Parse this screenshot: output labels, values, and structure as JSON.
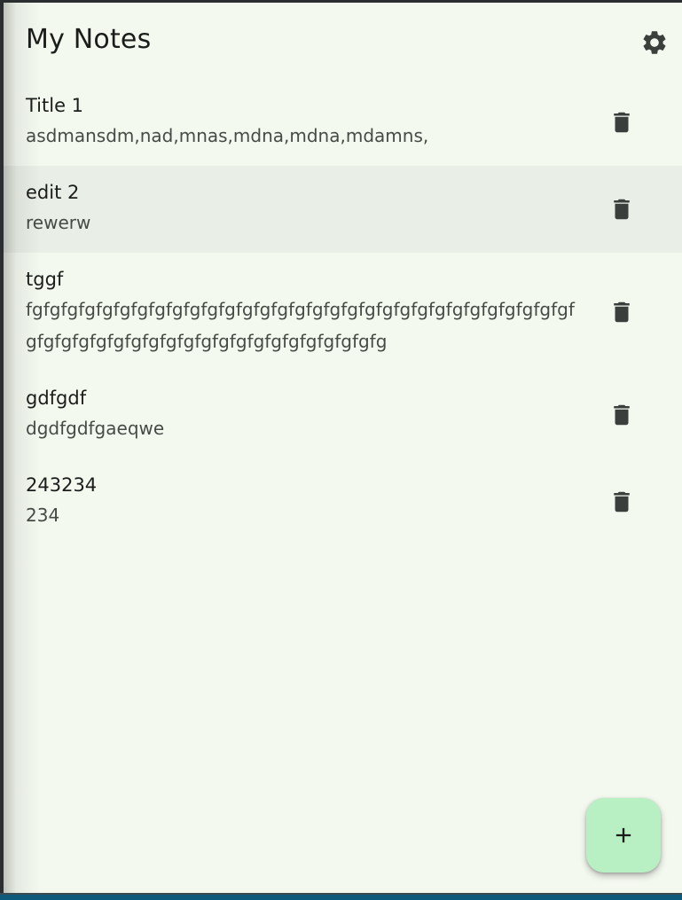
{
  "app_bar": {
    "title": "My Notes",
    "settings_icon": "gear-icon"
  },
  "notes": [
    {
      "title": "Title 1",
      "content": "asdmansdm,nad,mnas,mdna,mdna,mdamns,",
      "selected": false
    },
    {
      "title": "edit 2",
      "content": "rewerw",
      "selected": true
    },
    {
      "title": "tggf",
      "content": "fgfgfgfgfgfgfgfgfgfgfgfgfgfgfgfgfgfgfgfgfgfgfgfgfgfgfgfgfgfgfgfgfgfgfgfgfgfgfgfgfgfgfgfgfgfgfgfgfgfgfgfg",
      "selected": false
    },
    {
      "title": "gdfgdf",
      "content": "dgdfgdfgaeqwe",
      "selected": false
    },
    {
      "title": "243234",
      "content": "234",
      "selected": false
    }
  ],
  "fab": {
    "icon": "plus-icon"
  },
  "colors": {
    "background": "#f4f9f0",
    "selected_row": "#e9eee6",
    "fab": "#b8f0c4",
    "icon": "#3b3f3b"
  }
}
